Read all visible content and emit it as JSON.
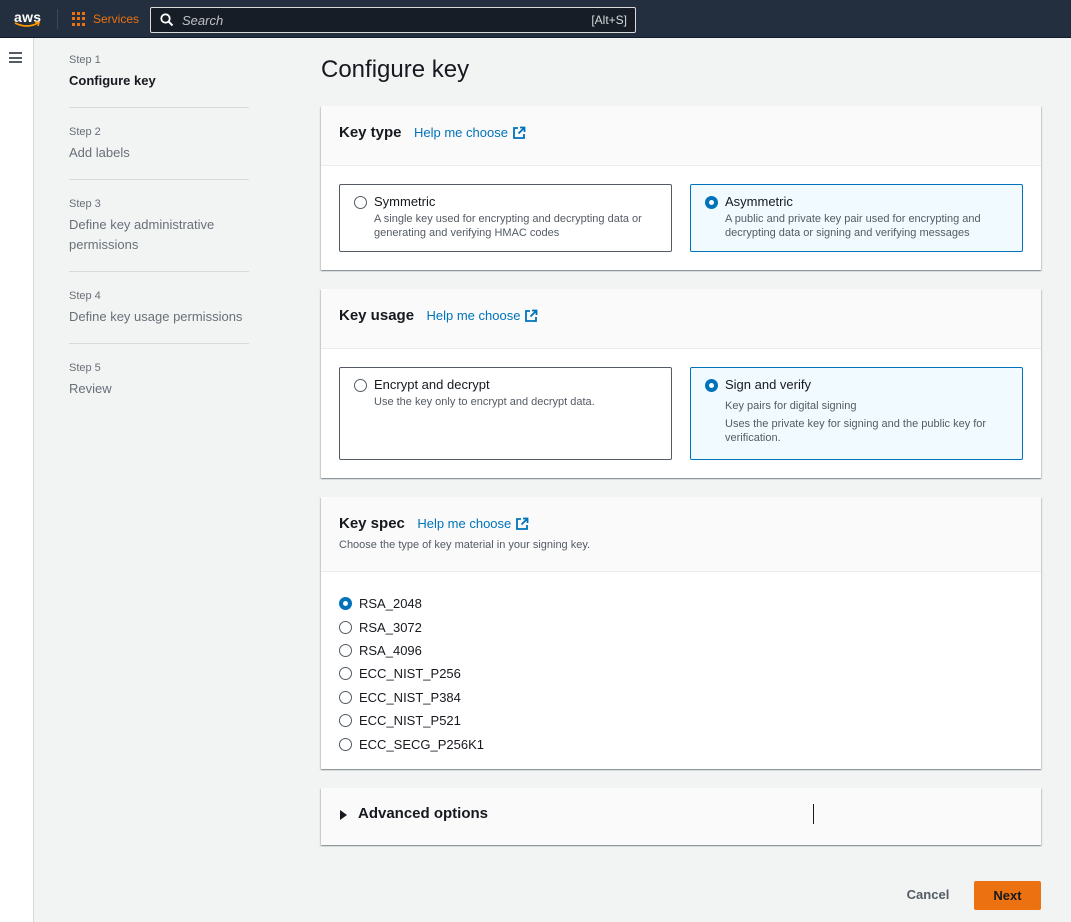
{
  "nav": {
    "logo_text": "aws",
    "services_label": "Services",
    "search_placeholder": "Search",
    "search_shortcut": "[Alt+S]"
  },
  "steps": [
    {
      "num": "Step 1",
      "title": "Configure key",
      "active": true
    },
    {
      "num": "Step 2",
      "title": "Add labels",
      "active": false
    },
    {
      "num": "Step 3",
      "title": "Define key administrative permissions",
      "active": false
    },
    {
      "num": "Step 4",
      "title": "Define key usage permissions",
      "active": false
    },
    {
      "num": "Step 5",
      "title": "Review",
      "active": false
    }
  ],
  "page_title": "Configure key",
  "key_type": {
    "title": "Key type",
    "help": "Help me choose",
    "options": [
      {
        "label": "Symmetric",
        "desc": "A single key used for encrypting and decrypting data or generating and verifying HMAC codes",
        "selected": false
      },
      {
        "label": "Asymmetric",
        "desc": "A public and private key pair used for encrypting and decrypting data or signing and verifying messages",
        "selected": true
      }
    ]
  },
  "key_usage": {
    "title": "Key usage",
    "help": "Help me choose",
    "options": [
      {
        "label": "Encrypt and decrypt",
        "desc": "Use the key only to encrypt and decrypt data.",
        "desc2": "",
        "selected": false
      },
      {
        "label": "Sign and verify",
        "desc": "Key pairs for digital signing",
        "desc2": "Uses the private key for signing and the public key for verification.",
        "selected": true
      }
    ]
  },
  "key_spec": {
    "title": "Key spec",
    "help": "Help me choose",
    "description": "Choose the type of key material in your signing key.",
    "options": [
      "RSA_2048",
      "RSA_3072",
      "RSA_4096",
      "ECC_NIST_P256",
      "ECC_NIST_P384",
      "ECC_NIST_P521",
      "ECC_SECG_P256K1"
    ],
    "selected": "RSA_2048"
  },
  "advanced": {
    "label": "Advanced options"
  },
  "footer": {
    "cancel": "Cancel",
    "next": "Next"
  },
  "colors": {
    "accent": "#ec7211",
    "link": "#0073bb",
    "nav_bg": "#232f3e"
  }
}
